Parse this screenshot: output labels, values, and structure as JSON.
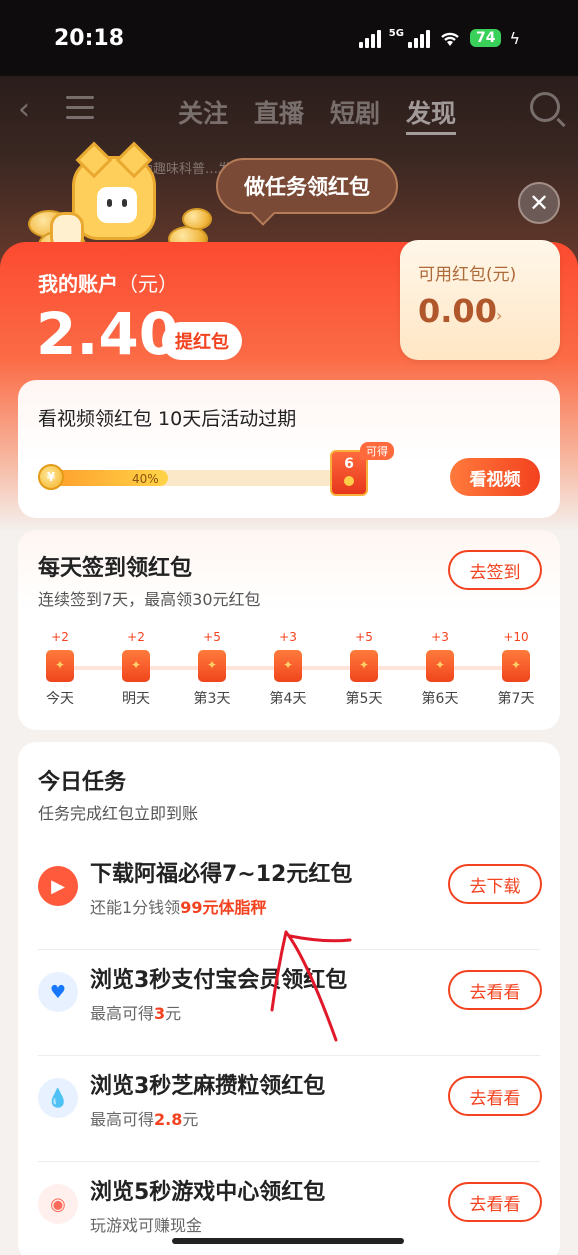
{
  "status": {
    "time": "20:18",
    "network": "5G",
    "battery": "74"
  },
  "nav": {
    "tabs": [
      "关注",
      "直播",
      "短剧",
      "发现"
    ],
    "active_index": 3
  },
  "background_caption": "为趣味科普…发生异物吞食请及时就医。",
  "bubble": "做任务领红包",
  "account": {
    "title": "我的账户",
    "unit": "（元）",
    "amount": "2.40",
    "withdraw_label": "提红包"
  },
  "available": {
    "label": "可用红包(元)",
    "value": "0.00",
    "chevron": "›"
  },
  "video": {
    "title": "看视频领红包 10天后活动过期",
    "progress": 0.4,
    "progress_label": "40%",
    "goal_count": "6",
    "goal_tag": "可得",
    "coin_symbol": "¥",
    "button": "看视频"
  },
  "checkin": {
    "title": "每天签到领红包",
    "subtitle": "连续签到7天，最高领30元红包",
    "button": "去签到",
    "days": [
      {
        "bonus": "+2",
        "label": "今天"
      },
      {
        "bonus": "+2",
        "label": "明天"
      },
      {
        "bonus": "+5",
        "label": "第3天"
      },
      {
        "bonus": "+3",
        "label": "第4天"
      },
      {
        "bonus": "+5",
        "label": "第5天"
      },
      {
        "bonus": "+3",
        "label": "第6天"
      },
      {
        "bonus": "+10",
        "label": "第7天"
      }
    ]
  },
  "tasks": {
    "title": "今日任务",
    "subtitle": "任务完成红包立即到账",
    "items": [
      {
        "name": "下载阿福必得7~12元红包",
        "desc_prefix": "还能1分钱领",
        "desc_highlight": "99元体脂秤",
        "desc_suffix": "",
        "button": "去下载",
        "icon": "afu-app-icon",
        "icon_color": "#ff5a3c"
      },
      {
        "name": "浏览3秒支付宝会员领红包",
        "desc_prefix": "最高可得",
        "desc_highlight": "3",
        "desc_suffix": "元",
        "button": "去看看",
        "icon": "alipay-member-icon",
        "icon_color": "#1677ff"
      },
      {
        "name": "浏览3秒芝麻攒粒领红包",
        "desc_prefix": "最高可得",
        "desc_highlight": "2.8",
        "desc_suffix": "元",
        "button": "去看看",
        "icon": "sesame-drop-icon",
        "icon_color": "#2a7dff"
      },
      {
        "name": "浏览5秒游戏中心领红包",
        "desc_prefix": "玩游戏可赚现金",
        "desc_highlight": "",
        "desc_suffix": "",
        "button": "去看看",
        "icon": "game-center-icon",
        "icon_color": "#ff6b5a"
      }
    ]
  },
  "colors": {
    "accent": "#f3421f",
    "card_bg": "#ffffff",
    "page_bg": "#f4f1ee"
  }
}
